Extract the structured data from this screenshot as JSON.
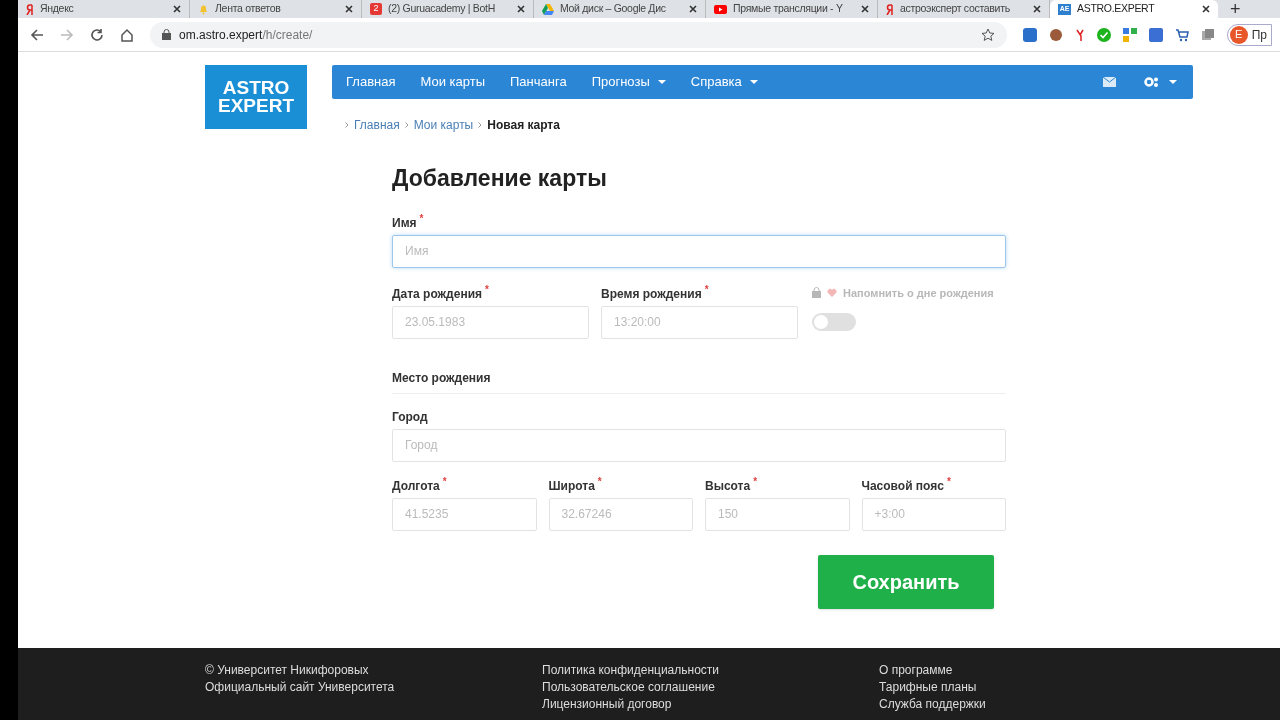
{
  "browser": {
    "tabs": [
      {
        "label": "Яндекс",
        "kind": "ya",
        "selected": false
      },
      {
        "label": "Лента ответов",
        "kind": "bell",
        "selected": false
      },
      {
        "label": "(2) Guruacademy | BotH",
        "kind": "badge",
        "badge": "2",
        "selected": false
      },
      {
        "label": "Мой диск – Google Дис",
        "kind": "drive",
        "selected": false
      },
      {
        "label": "Прямые трансляции - Y",
        "kind": "video",
        "selected": false
      },
      {
        "label": "астроэксперт составить",
        "kind": "ya",
        "selected": false
      },
      {
        "label": "ASTRO.EXPERT",
        "kind": "site",
        "icon_text": "AE",
        "selected": true
      }
    ],
    "new_tab": "+",
    "url_host": "om.astro.expert",
    "url_path": "/h/create/",
    "profile_initial": "E",
    "profile_label": "Пр"
  },
  "logo": {
    "line1": "ASTRO",
    "line2": "EXPERT"
  },
  "nav": [
    {
      "label": "Главная",
      "dropdown": false
    },
    {
      "label": "Мои карты",
      "dropdown": false
    },
    {
      "label": "Панчанга",
      "dropdown": false
    },
    {
      "label": "Прогнозы",
      "dropdown": true
    },
    {
      "label": "Справка",
      "dropdown": true
    }
  ],
  "breadcrumbs": [
    {
      "label": "Главная",
      "current": false
    },
    {
      "label": "Мои карты",
      "current": false
    },
    {
      "label": "Новая карта",
      "current": true
    }
  ],
  "title": "Добавление карты",
  "name_field": {
    "label": "Имя",
    "required_mark": "*",
    "placeholder": "Имя",
    "focused": true
  },
  "date_row": [
    {
      "label": "Дата рождения",
      "required_mark": "*",
      "placeholder": "23.05.1983"
    },
    {
      "label": "Время рождения",
      "required_mark": "*",
      "placeholder": "13:20:00"
    }
  ],
  "reminder": {
    "label": "Напомнить о дне рождения",
    "disabled": true,
    "on": false
  },
  "section": "Место рождения",
  "city_field": {
    "label": "Город",
    "placeholder": "Город"
  },
  "coords_row": [
    {
      "label": "Долгота",
      "required_mark": "*",
      "placeholder": "41.5235"
    },
    {
      "label": "Широта",
      "required_mark": "*",
      "placeholder": "32.67246"
    },
    {
      "label": "Высота",
      "required_mark": "*",
      "placeholder": "150"
    },
    {
      "label": "Часовой пояс",
      "required_mark": "*",
      "placeholder": "+3:00"
    }
  ],
  "save_button": "Сохранить",
  "footer": [
    [
      "© Университет Никифоровых",
      "Официальный сайт Университета"
    ],
    [
      "Политика конфиденциальности",
      "Пользовательское соглашение",
      "Лицензионный договор"
    ],
    [
      "О программе",
      "Тарифные планы",
      "Служба поддержки"
    ]
  ]
}
